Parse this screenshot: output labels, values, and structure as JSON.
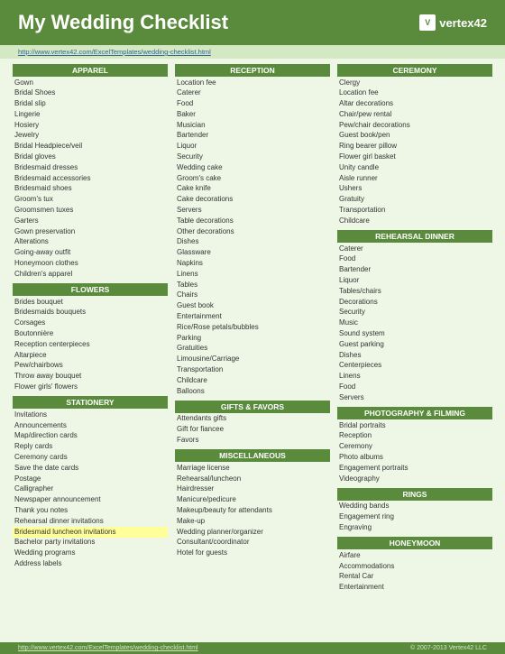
{
  "header": {
    "title": "My Wedding Checklist",
    "logo_line1": "vertex42",
    "url": "http://www.vertex42.com/ExcelTemplates/wedding-checklist.html"
  },
  "footer": {
    "url": "http://www.vertex42.com/ExcelTemplates/wedding-checklist.html",
    "copyright": "© 2007-2013 Vertex42 LLC"
  },
  "columns": [
    {
      "sections": [
        {
          "header": "APPAREL",
          "items": [
            "Gown",
            "Bridal Shoes",
            "Bridal slip",
            "Lingerie",
            "Hosiery",
            "Jewelry",
            "Bridal Headpiece/veil",
            "Bridal gloves",
            "Bridesmaid dresses",
            "Bridesmaid accessories",
            "Bridesmaid shoes",
            "Groom's tux",
            "Groomsmen tuxes",
            "Garters",
            "Gown preservation",
            "Alterations",
            "Going-away outfit",
            "Honeymoon clothes",
            "Children's apparel"
          ]
        },
        {
          "header": "FLOWERS",
          "items": [
            "Brides bouquet",
            "Bridesmaids bouquets",
            "Corsages",
            "Boutonnière",
            "Reception centerpieces",
            "Altarpiece",
            "Pew/chairbows",
            "Throw away bouquet",
            "Flower girls' flowers"
          ]
        },
        {
          "header": "STATIONERY",
          "items": [
            "Invitations",
            "Announcements",
            "Map/direction cards",
            "Reply cards",
            "Ceremony cards",
            "Save the date cards",
            "Postage",
            "Calligrapher",
            "Newspaper announcement",
            "Thank you notes",
            "Rehearsal dinner invitations",
            "Bridesmaid luncheon invitations",
            "Bachelor party invitations",
            "Wedding programs",
            "Address labels"
          ]
        }
      ]
    },
    {
      "sections": [
        {
          "header": "RECEPTION",
          "items": [
            "Location fee",
            "Caterer",
            "Food",
            "Baker",
            "Musician",
            "Bartender",
            "Liquor",
            "Security",
            "Wedding cake",
            "Groom's cake",
            "Cake knife",
            "Cake decorations",
            "Servers",
            "Table decorations",
            "Other decorations",
            "Dishes",
            "Glassware",
            "Napkins",
            "Linens",
            "Tables",
            "Chairs",
            "Guest book",
            "Entertainment",
            "Rice/Rose petals/bubbles",
            "Parking",
            "Gratuities",
            "Limousine/Carriage",
            "Transportation",
            "Childcare",
            "Balloons"
          ]
        },
        {
          "header": "GIFTS & FAVORS",
          "items": [
            "Attendants gifts",
            "Gift for fiancee",
            "Favors"
          ]
        },
        {
          "header": "MISCELLANEOUS",
          "items": [
            "Marriage license",
            "Rehearsal/luncheon",
            "Hairdresser",
            "Manicure/pedicure",
            "Makeup/beauty for attendants",
            "Make-up",
            "Wedding planner/organizer",
            "Consultant/coordinator",
            "Hotel for guests"
          ]
        }
      ]
    },
    {
      "sections": [
        {
          "header": "CEREMONY",
          "items": [
            "Clergy",
            "Location fee",
            "Altar decorations",
            "Chair/pew rental",
            "Pew/chair decorations",
            "Guest book/pen",
            "Ring bearer pillow",
            "Flower girl basket",
            "Unity candle",
            "Aisle runner",
            "Ushers",
            "Gratuity",
            "Transportation",
            "Childcare"
          ]
        },
        {
          "header": "REHEARSAL DINNER",
          "items": [
            "Caterer",
            "Food",
            "Bartender",
            "Liquor",
            "Tables/chairs",
            "Decorations",
            "Security",
            "Music",
            "Sound system",
            "Guest parking",
            "Dishes",
            "Centerpieces",
            "Linens",
            "Food",
            "Servers"
          ]
        },
        {
          "header": "PHOTOGRAPHY & FILMING",
          "items": [
            "Bridal portraits",
            "Reception",
            "Ceremony",
            "Photo albums",
            "Engagement portraits",
            "Videography"
          ]
        },
        {
          "header": "RINGS",
          "items": [
            "Wedding bands",
            "Engagement ring",
            "Engraving"
          ]
        },
        {
          "header": "HONEYMOON",
          "items": [
            "Airfare",
            "Accommodations",
            "Rental Car",
            "Entertainment"
          ]
        }
      ]
    }
  ]
}
